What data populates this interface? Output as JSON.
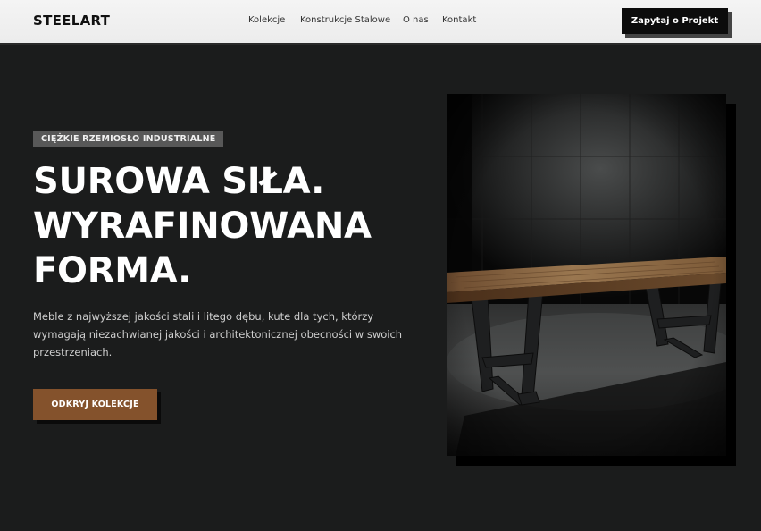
{
  "header": {
    "logo": "STEELART",
    "nav": [
      {
        "label": "Kolekcje"
      },
      {
        "label": "Konstrukcje Stalowe"
      },
      {
        "label": "O nas"
      },
      {
        "label": "Kontakt"
      }
    ],
    "cta_label": "Zapytaj o Projekt"
  },
  "hero": {
    "badge": "CIĘŻKIE RZEMIOSŁO INDUSTRIALNE",
    "headline": [
      "SUROWA SIŁA.",
      "WYRAFINOWANA",
      "FORMA."
    ],
    "description": "Meble z najwyższej jakości stali i litego dębu, kute dla tych, którzy wymagają niezachwianej jakości i architektonicznej obecności w swoich przestrzeniach.",
    "cta_label": "ODKRYJ KOLEKCJE",
    "image_subject": "steel-and-oak-table"
  },
  "colors": {
    "background": "#1b1c1c",
    "accent": "#84522c",
    "header_bg": "#f0f0f0",
    "badge_bg": "#585858"
  }
}
